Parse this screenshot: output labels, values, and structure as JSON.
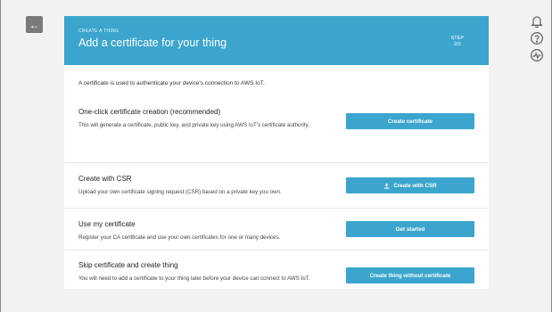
{
  "icons": {
    "back": "arrow-left-icon",
    "notifications": "bell-icon",
    "help": "question-circle-icon",
    "feedback": "pulse-circle-icon",
    "upload": "upload-icon"
  },
  "colors": {
    "accent": "#3ba5cd",
    "background": "#f2f2f2",
    "back_button": "#7a7a7a"
  },
  "header": {
    "eyebrow": "CREATE A THING",
    "title": "Add a certificate for your thing",
    "step_label": "STEP",
    "step_value": "2/3"
  },
  "intro": "A certificate is used to authenticate your device's connection to AWS IoT.",
  "options": [
    {
      "title": "One-click certificate creation (recommended)",
      "description": "This will generate a certificate, public key, and private key using AWS IoT's certificate authority.",
      "button": "Create certificate"
    },
    {
      "title": "Create with CSR",
      "description": "Upload your own certificate signing request (CSR) based on a private key you own.",
      "button": "Create with CSR"
    },
    {
      "title": "Use my certificate",
      "description": "Register your CA certificate and use your own certificates for one or many devices.",
      "button": "Get started"
    },
    {
      "title": "Skip certificate and create thing",
      "description": "You will need to add a certificate to your thing later before your device can connect to AWS IoT.",
      "button": "Create thing without certificate"
    }
  ]
}
